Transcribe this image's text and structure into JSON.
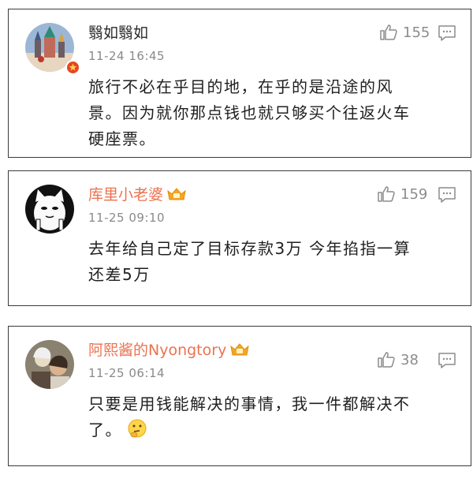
{
  "comments": [
    {
      "username": "翳如翳如",
      "time": "11-24 16:45",
      "likes": "155",
      "lines": [
        "旅行不必在乎目的地，在乎的是沿途的风",
        "景。因为就你那点钱也就只够买个往返火车",
        "硬座票。"
      ],
      "verified": true,
      "vip": false,
      "name_color": "#2b2b2b"
    },
    {
      "username": "库里小老婆",
      "time": "11-25 09:10",
      "likes": "159",
      "lines": [
        "去年给自己定了目标存款3万  今年掐指一算",
        "还差5万"
      ],
      "verified": false,
      "vip": true,
      "name_color": "#eb7350"
    },
    {
      "username": "阿熙酱的Nyongtory",
      "time": "11-25 06:14",
      "likes": "38",
      "lines": [
        "只要是用钱能解决的事情，我一件都解决不",
        "了。"
      ],
      "verified": false,
      "vip": true,
      "name_color": "#eb7350",
      "trailing_emoji": "thinking-emoji"
    }
  ],
  "icons": {
    "like": "thumbs-up-icon",
    "reply": "comment-bubble-icon",
    "vip": "vip-crown-badge-icon",
    "verified": "verified-badge-icon"
  },
  "colors": {
    "link_name": "#eb7350",
    "meta_gray": "#8a8a8a",
    "verified_red": "#e64525",
    "vip_orange": "#f5a623"
  }
}
